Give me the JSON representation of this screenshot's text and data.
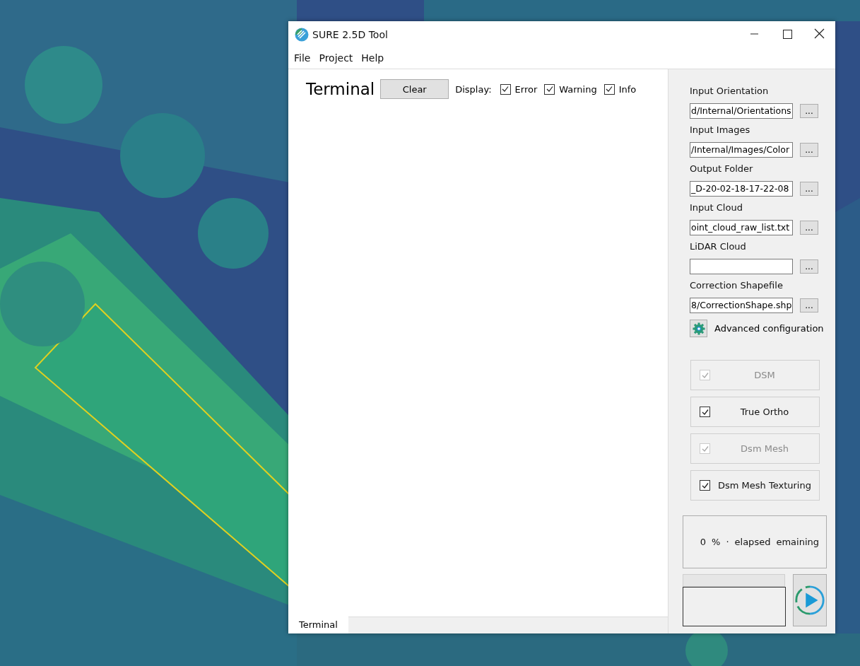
{
  "window": {
    "title": "SURE 2.5D Tool"
  },
  "menu": [
    "File",
    "Project",
    "Help"
  ],
  "terminal": {
    "title": "Terminal",
    "clear_button": "Clear",
    "display_label": "Display:",
    "filters": [
      {
        "label": "Error",
        "checked": true
      },
      {
        "label": "Warning",
        "checked": true
      },
      {
        "label": "Info",
        "checked": true
      }
    ]
  },
  "inputs": [
    {
      "label": "Input Orientation",
      "value": "d/Internal/Orientations",
      "browse": "..."
    },
    {
      "label": "Input Images",
      "value": "/Internal/Images/Color",
      "browse": "..."
    },
    {
      "label": "Output Folder",
      "value": "_D-20-02-18-17-22-08",
      "browse": "..."
    },
    {
      "label": "Input Cloud",
      "value": "oint_cloud_raw_list.txt",
      "browse": "..."
    },
    {
      "label": "LiDAR Cloud",
      "browse": "..."
    },
    {
      "label": "Correction Shapefile",
      "value": "8/CorrectionShape.shp",
      "browse": "..."
    }
  ],
  "advanced": {
    "label": "Advanced configuration"
  },
  "outputs": [
    {
      "label": "DSM",
      "checked": true,
      "disabled": true
    },
    {
      "label": "True Ortho",
      "checked": true,
      "disabled": false
    },
    {
      "label": "Dsm Mesh",
      "checked": true,
      "disabled": true
    },
    {
      "label": "Dsm Mesh Texturing",
      "checked": true,
      "disabled": false
    }
  ],
  "progress": {
    "parts": [
      "0",
      "%",
      "·",
      "elapsed",
      "emaining"
    ],
    "level": 0
  },
  "bottom_tabs": [
    {
      "label": "Terminal",
      "selected": true
    }
  ]
}
